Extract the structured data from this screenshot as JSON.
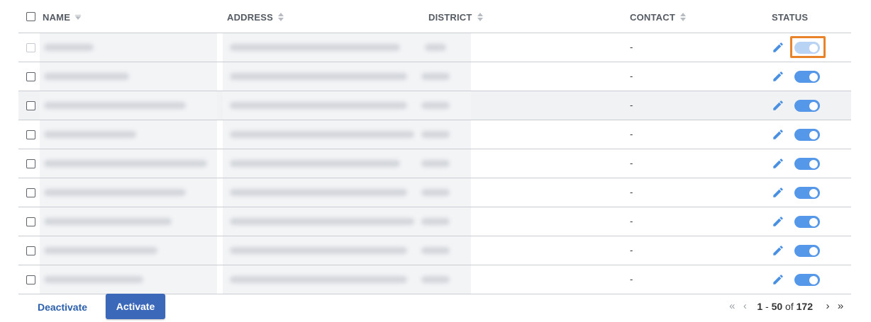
{
  "columns": {
    "name": "NAME",
    "address": "ADDRESS",
    "district": "DISTRICT",
    "contact": "CONTACT",
    "status": "STATUS"
  },
  "rows": [
    {
      "contact": "-",
      "status": "active",
      "disabled": true
    },
    {
      "contact": "-",
      "status": "active"
    },
    {
      "contact": "-",
      "status": "active"
    },
    {
      "contact": "-",
      "status": "active"
    },
    {
      "contact": "-",
      "status": "active"
    },
    {
      "contact": "-",
      "status": "active"
    },
    {
      "contact": "-",
      "status": "active"
    },
    {
      "contact": "-",
      "status": "active"
    },
    {
      "contact": "-",
      "status": "active"
    }
  ],
  "footer": {
    "deactivate_label": "Deactivate",
    "activate_label": "Activate",
    "range_start": "1",
    "range_sep": " - ",
    "range_end": "50",
    "of_label": " of ",
    "total": "172"
  },
  "colors": {
    "toggle_on": "#5597e8",
    "highlight": "#e8832a",
    "primary_button": "#3b68b9"
  },
  "icons": [
    "sort-icon",
    "pencil-icon",
    "first-page-icon",
    "prev-page-icon",
    "next-page-icon",
    "last-page-icon"
  ]
}
